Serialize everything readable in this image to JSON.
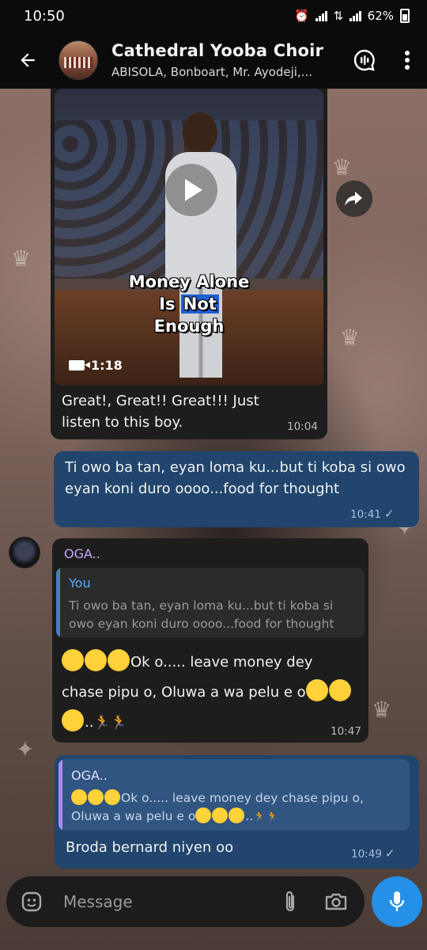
{
  "status_bar": {
    "time": "10:50",
    "battery": "62%"
  },
  "header": {
    "title": "Cathedral Yooba Choir",
    "subtitle": "ABISOLA, Bonboart, Mr. Ayodeji,..."
  },
  "messages": [
    {
      "type": "video",
      "direction": "incoming",
      "video": {
        "overlay_line1": "Money Alone",
        "overlay_line2_a": "Is",
        "overlay_line2_b": "Not",
        "overlay_line3": "Enough",
        "duration": "1:18"
      },
      "caption": "Great!, Great!! Great!!! Just listen to this boy.",
      "time": "10:04"
    },
    {
      "type": "text",
      "direction": "outgoing",
      "text": "Ti owo ba tan, eyan loma ku...but ti koba si owo eyan koni duro oooo...food for thought",
      "time": "10:41",
      "status": "sent"
    },
    {
      "type": "reply",
      "direction": "incoming",
      "sender": "OGA..",
      "quote_name": "You",
      "quote_text": "Ti owo ba tan, eyan loma ku...but ti koba si owo eyan koni duro oooo...food for thought",
      "text_line1": "Ok o..... leave money dey",
      "text_line2": "chase pipu o, Oluwa a wa pelu e o",
      "text_line3": "..",
      "time": "10:47"
    },
    {
      "type": "reply",
      "direction": "outgoing",
      "quote_name": "OGA..",
      "quote_text_line1": "Ok o..... leave money dey chase pipu o,",
      "quote_text_line2": "Oluwa a wa pelu e o",
      "quote_text_line2_tail": "..",
      "text": "Broda bernard niyen oo",
      "time": "10:49",
      "status": "sent"
    }
  ],
  "composer": {
    "placeholder": "Message"
  },
  "icons": {
    "back": "arrow-left-icon",
    "voice_chat": "voice-chat-icon",
    "menu": "more-vertical-icon",
    "forward": "forward-icon",
    "emoji": "emoji-icon",
    "attach": "paperclip-icon",
    "camera": "camera-icon",
    "mic": "microphone-icon"
  },
  "colors": {
    "incoming_bubble": "#1d1d1d",
    "outgoing_bubble": "#21456d",
    "accent": "#2490e8",
    "sender_name": "#c9a6ff"
  }
}
